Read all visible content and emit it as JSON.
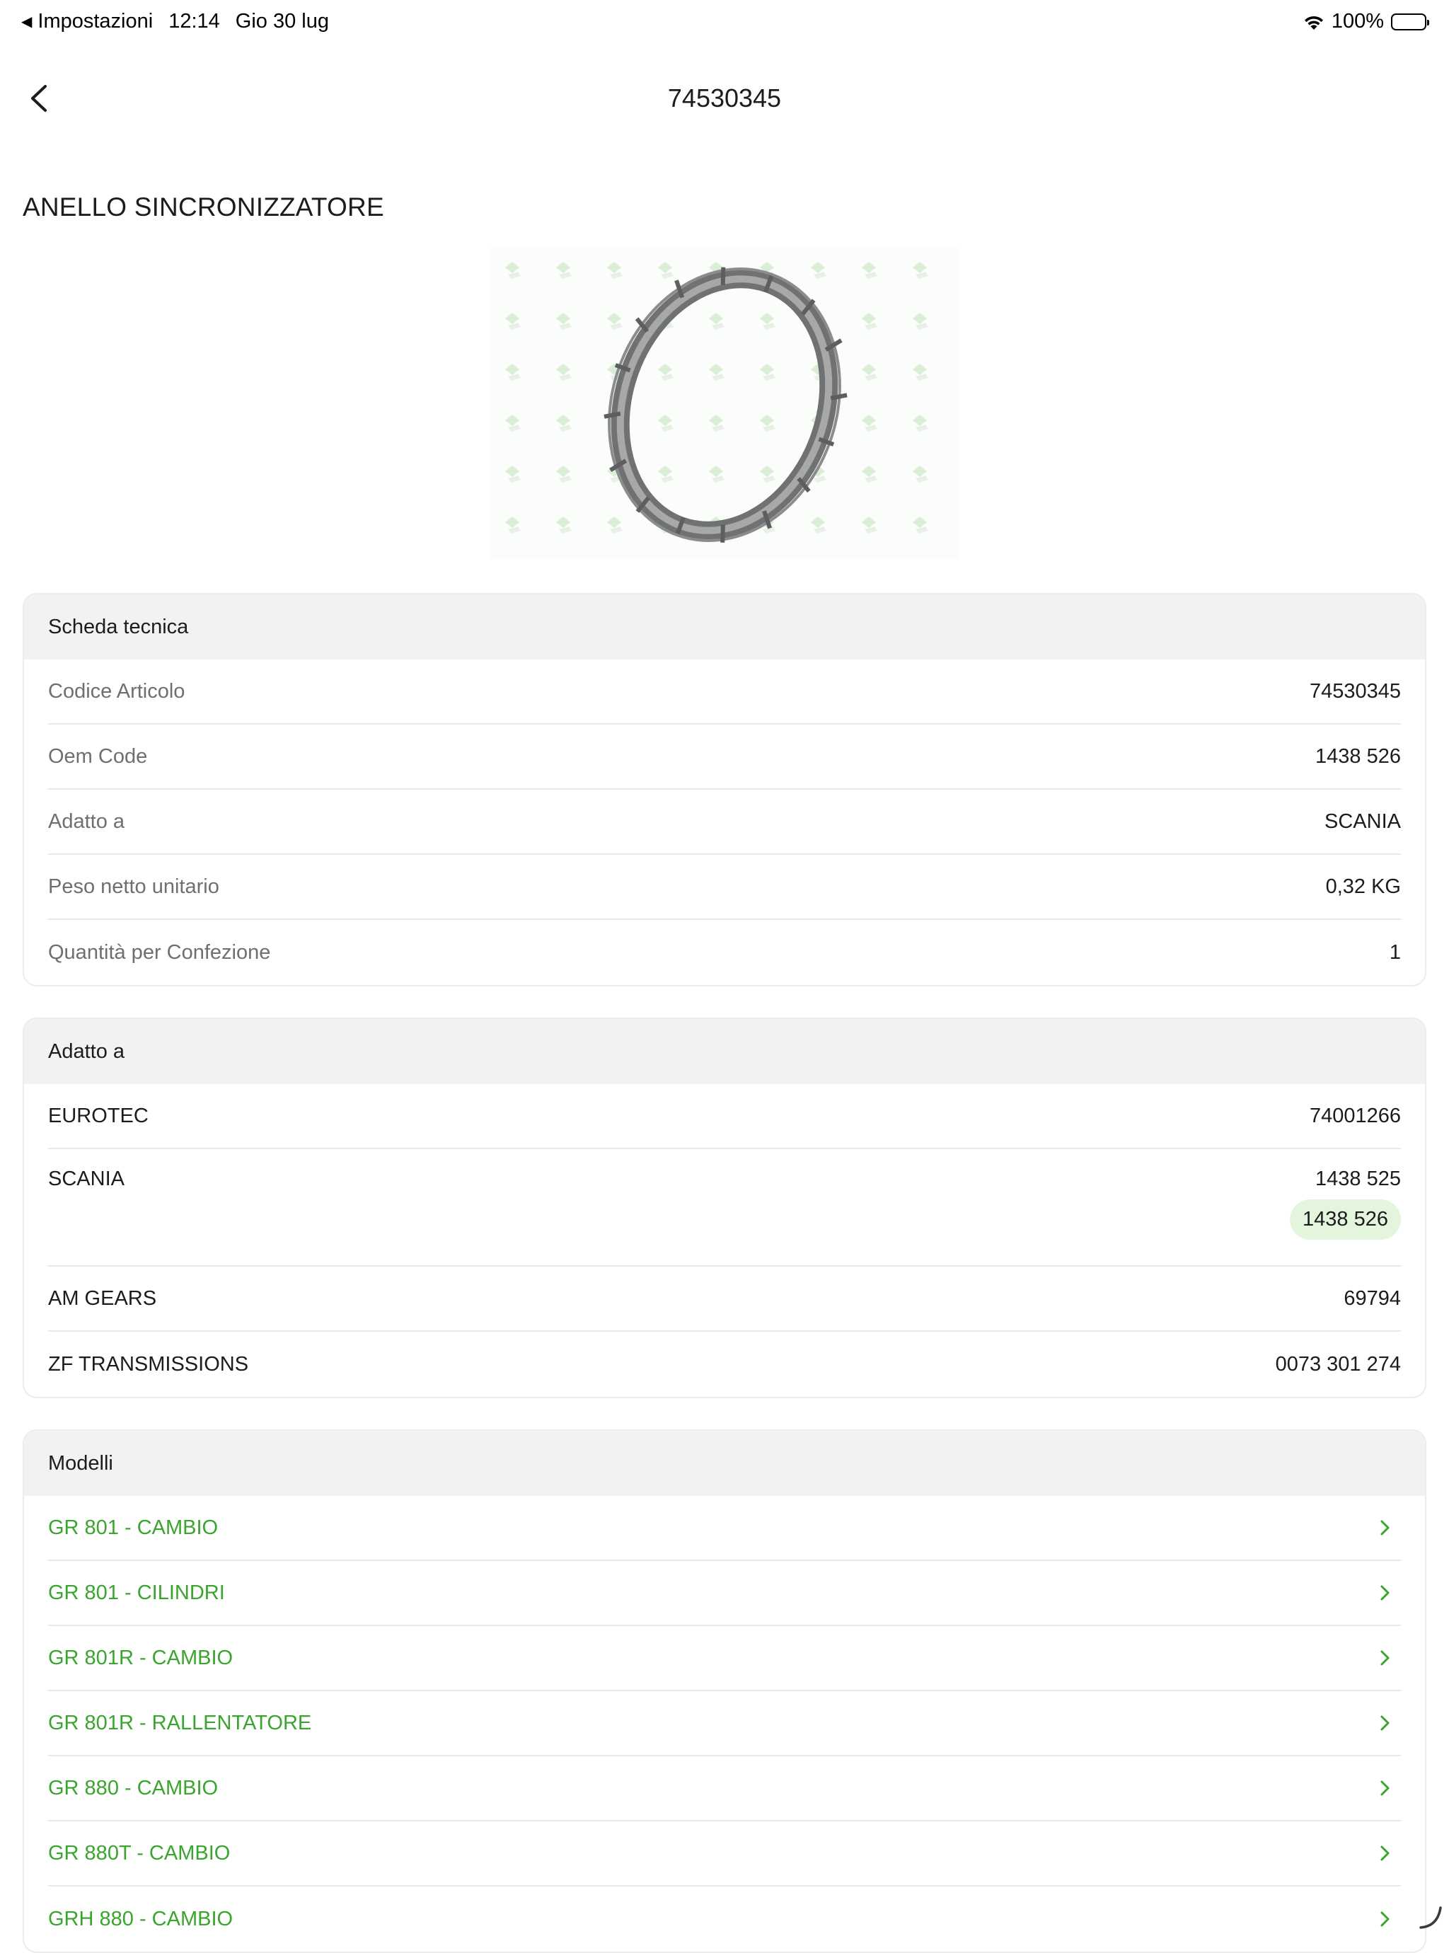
{
  "status_bar": {
    "back_app": "Impostazioni",
    "time": "12:14",
    "date": "Gio 30 lug",
    "battery": "100%"
  },
  "nav": {
    "title": "74530345"
  },
  "product": {
    "name": "ANELLO SINCRONIZZATORE"
  },
  "technical_sheet": {
    "header": "Scheda tecnica",
    "rows": [
      {
        "label": "Codice Articolo",
        "value": "74530345"
      },
      {
        "label": "Oem Code",
        "value": "1438 526"
      },
      {
        "label": "Adatto a",
        "value": "SCANIA"
      },
      {
        "label": "Peso netto unitario",
        "value": "0,32 KG"
      },
      {
        "label": "Quantità per Confezione",
        "value": "1"
      }
    ]
  },
  "fits": {
    "header": "Adatto a",
    "rows": [
      {
        "label": "EUROTEC",
        "value": "74001266"
      },
      {
        "label": "SCANIA",
        "value": "1438 525",
        "highlight": "1438 526"
      },
      {
        "label": "AM GEARS",
        "value": "69794"
      },
      {
        "label": "ZF TRANSMISSIONS",
        "value": "0073 301 274"
      }
    ]
  },
  "models": {
    "header": "Modelli",
    "items": [
      "GR 801 - CAMBIO",
      "GR 801 - CILINDRI",
      "GR 801R - CAMBIO",
      "GR 801R - RALLENTATORE",
      "GR 880 - CAMBIO",
      "GR 880T - CAMBIO",
      "GRH 880 - CAMBIO"
    ]
  },
  "colors": {
    "accent_green": "#3aa52e",
    "chip_bg": "#e4f5dd",
    "header_bg": "#f2f2f2"
  }
}
